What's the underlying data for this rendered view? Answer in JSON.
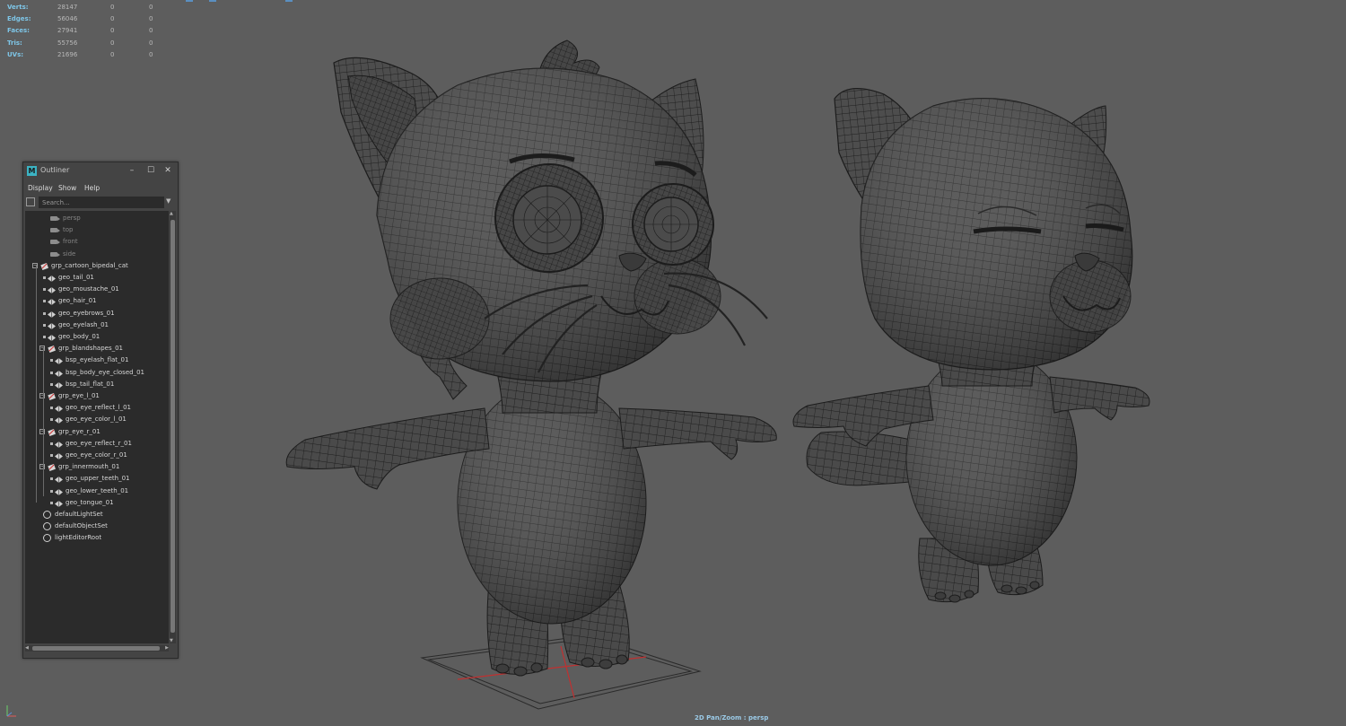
{
  "hud": {
    "rows": [
      {
        "label": "Verts:",
        "v1": "28147",
        "v2": "0",
        "v3": "0"
      },
      {
        "label": "Edges:",
        "v1": "56046",
        "v2": "0",
        "v3": "0"
      },
      {
        "label": "Faces:",
        "v1": "27941",
        "v2": "0",
        "v3": "0"
      },
      {
        "label": "Tris:",
        "v1": "55756",
        "v2": "0",
        "v3": "0"
      },
      {
        "label": "UVs:",
        "v1": "21696",
        "v2": "0",
        "v3": "0"
      }
    ]
  },
  "outliner": {
    "title": "Outliner",
    "app_icon": "M",
    "menus": {
      "display": "Display",
      "show": "Show",
      "help": "Help"
    },
    "search_placeholder": "Search...",
    "items": [
      {
        "label": "persp",
        "icon": "camera-icon",
        "dim": true
      },
      {
        "label": "top",
        "icon": "camera-icon",
        "dim": true
      },
      {
        "label": "front",
        "icon": "camera-icon",
        "dim": true
      },
      {
        "label": "side",
        "icon": "camera-icon",
        "dim": true
      },
      {
        "label": "grp_cartoon_bipedal_cat",
        "icon": "group-icon"
      },
      {
        "label": "geo_tail_01",
        "icon": "mesh-icon"
      },
      {
        "label": "geo_moustache_01",
        "icon": "mesh-icon"
      },
      {
        "label": "geo_hair_01",
        "icon": "mesh-icon"
      },
      {
        "label": "geo_eyebrows_01",
        "icon": "mesh-icon"
      },
      {
        "label": "geo_eyelash_01",
        "icon": "mesh-icon"
      },
      {
        "label": "geo_body_01",
        "icon": "mesh-icon"
      },
      {
        "label": "grp_blandshapes_01",
        "icon": "group-icon"
      },
      {
        "label": "bsp_eyelash_flat_01",
        "icon": "mesh-icon"
      },
      {
        "label": "bsp_body_eye_closed_01",
        "icon": "mesh-icon"
      },
      {
        "label": "bsp_tail_flat_01",
        "icon": "mesh-icon"
      },
      {
        "label": "grp_eye_l_01",
        "icon": "group-icon"
      },
      {
        "label": "geo_eye_reflect_l_01",
        "icon": "mesh-icon"
      },
      {
        "label": "geo_eye_color_l_01",
        "icon": "mesh-icon"
      },
      {
        "label": "grp_eye_r_01",
        "icon": "group-icon"
      },
      {
        "label": "geo_eye_reflect_r_01",
        "icon": "mesh-icon"
      },
      {
        "label": "geo_eye_color_r_01",
        "icon": "mesh-icon"
      },
      {
        "label": "grp_innermouth_01",
        "icon": "group-icon"
      },
      {
        "label": "geo_upper_teeth_01",
        "icon": "mesh-icon"
      },
      {
        "label": "geo_lower_teeth_01",
        "icon": "mesh-icon"
      },
      {
        "label": "geo_tongue_01",
        "icon": "mesh-icon"
      },
      {
        "label": "defaultLightSet",
        "icon": "set-icon"
      },
      {
        "label": "defaultObjectSet",
        "icon": "set-icon"
      },
      {
        "label": "lightEditorRoot",
        "icon": "set-icon"
      }
    ]
  },
  "viewport": {
    "camera_label": "2D Pan/Zoom : persp"
  },
  "colors": {
    "viewport_bg": "#5d5d5d",
    "hud_label": "#7ec6e8",
    "mesh_fill": "#4b4b4b",
    "wire": "#1c1c1c",
    "grid_red": "#c03030",
    "accent": "#3bb3c3"
  }
}
